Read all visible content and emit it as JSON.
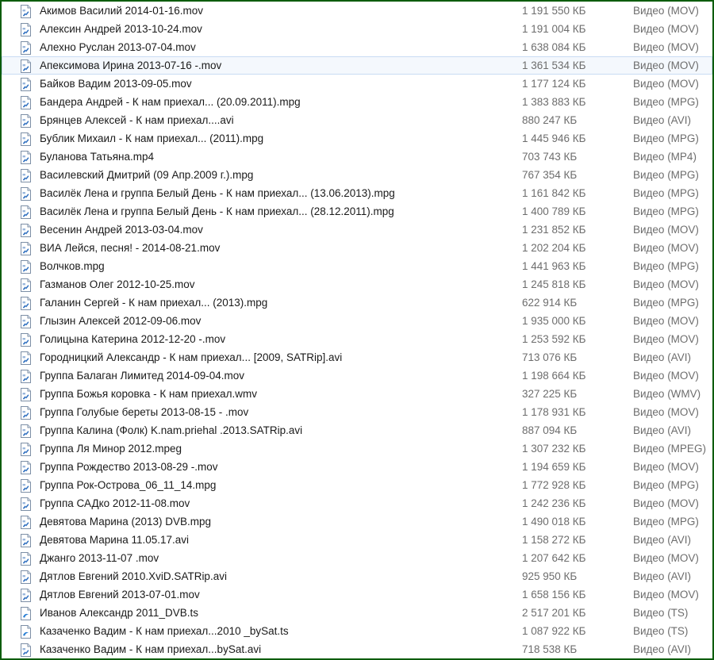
{
  "file_list": {
    "hover_row_index": 3,
    "rows": [
      {
        "name": "Акимов Василий 2014-01-16.mov",
        "size": "1 191 550 КБ",
        "type": "Видео (MOV)",
        "icon": "video-file-icon"
      },
      {
        "name": "Алексин Андрей 2013-10-24.mov",
        "size": "1 191 004 КБ",
        "type": "Видео (MOV)",
        "icon": "video-file-icon"
      },
      {
        "name": "Алехно Руслан 2013-07-04.mov",
        "size": "1 638 084 КБ",
        "type": "Видео (MOV)",
        "icon": "video-file-icon"
      },
      {
        "name": "Апексимова Ирина 2013-07-16 -.mov",
        "size": "1 361 534 КБ",
        "type": "Видео (MOV)",
        "icon": "video-file-icon"
      },
      {
        "name": "Байков Вадим 2013-09-05.mov",
        "size": "1 177 124 КБ",
        "type": "Видео (MOV)",
        "icon": "video-file-icon"
      },
      {
        "name": "Бандера Андрей - К нам приехал... (20.09.2011).mpg",
        "size": "1 383 883 КБ",
        "type": "Видео (MPG)",
        "icon": "video-file-icon"
      },
      {
        "name": "Брянцев Алексей - К нам приехал....avi",
        "size": "880 247 КБ",
        "type": "Видео (AVI)",
        "icon": "video-file-icon"
      },
      {
        "name": "Бублик Михаил - К нам приехал... (2011).mpg",
        "size": "1 445 946 КБ",
        "type": "Видео (MPG)",
        "icon": "video-file-icon"
      },
      {
        "name": "Буланова Татьяна.mp4",
        "size": "703 743 КБ",
        "type": "Видео (MP4)",
        "icon": "video-file-icon"
      },
      {
        "name": "Василевский Дмитрий (09 Апр.2009 г.).mpg",
        "size": "767 354 КБ",
        "type": "Видео (MPG)",
        "icon": "video-file-icon"
      },
      {
        "name": "Василёк Лена и группа Белый День - К нам приехал... (13.06.2013).mpg",
        "size": "1 161 842 КБ",
        "type": "Видео (MPG)",
        "icon": "video-file-icon"
      },
      {
        "name": "Василёк Лена и группа Белый День - К нам приехал... (28.12.2011).mpg",
        "size": "1 400 789 КБ",
        "type": "Видео (MPG)",
        "icon": "video-file-icon"
      },
      {
        "name": "Весенин Андрей 2013-03-04.mov",
        "size": "1 231 852 КБ",
        "type": "Видео (MOV)",
        "icon": "video-file-icon"
      },
      {
        "name": "ВИА Лейся, песня! - 2014-08-21.mov",
        "size": "1 202 204 КБ",
        "type": "Видео (MOV)",
        "icon": "video-file-icon"
      },
      {
        "name": "Волчков.mpg",
        "size": "1 441 963 КБ",
        "type": "Видео (MPG)",
        "icon": "video-file-icon"
      },
      {
        "name": "Газманов Олег 2012-10-25.mov",
        "size": "1 245 818 КБ",
        "type": "Видео (MOV)",
        "icon": "video-file-icon"
      },
      {
        "name": "Галанин Сергей - К нам приехал... (2013).mpg",
        "size": "622 914 КБ",
        "type": "Видео (MPG)",
        "icon": "video-file-icon"
      },
      {
        "name": "Глызин Алексей 2012-09-06.mov",
        "size": "1 935 000 КБ",
        "type": "Видео (MOV)",
        "icon": "video-file-icon"
      },
      {
        "name": "Голицына Катерина 2012-12-20 -.mov",
        "size": "1 253 592 КБ",
        "type": "Видео (MOV)",
        "icon": "video-file-icon"
      },
      {
        "name": "Городницкий Александр - К нам приехал...  [2009, SATRip].avi",
        "size": "713 076 КБ",
        "type": "Видео (AVI)",
        "icon": "video-file-icon"
      },
      {
        "name": "Группа Балаган Лимитед 2014-09-04.mov",
        "size": "1 198 664 КБ",
        "type": "Видео (MOV)",
        "icon": "video-file-icon"
      },
      {
        "name": "Группа Божья коровка - К нам приехал.wmv",
        "size": "327 225 КБ",
        "type": "Видео (WMV)",
        "icon": "video-file-icon"
      },
      {
        "name": "Группа Голубые береты 2013-08-15 - .mov",
        "size": "1 178 931 КБ",
        "type": "Видео (MOV)",
        "icon": "video-file-icon"
      },
      {
        "name": "Группа Калина (Фолк) K.nam.priehal .2013.SATRip.avi",
        "size": "887 094 КБ",
        "type": "Видео (AVI)",
        "icon": "video-file-icon"
      },
      {
        "name": "Группа Ля Минор 2012.mpeg",
        "size": "1 307 232 КБ",
        "type": "Видео (MPEG)",
        "icon": "video-file-icon"
      },
      {
        "name": "Группа Рождество 2013-08-29 -.mov",
        "size": "1 194 659 КБ",
        "type": "Видео (MOV)",
        "icon": "video-file-icon"
      },
      {
        "name": "Группа Рок-Острова_06_11_14.mpg",
        "size": "1 772 928 КБ",
        "type": "Видео (MPG)",
        "icon": "video-file-icon"
      },
      {
        "name": "Группа САДко 2012-11-08.mov",
        "size": "1 242 236 КБ",
        "type": "Видео (MOV)",
        "icon": "video-file-icon"
      },
      {
        "name": "Девятова Марина (2013) DVB.mpg",
        "size": "1 490 018 КБ",
        "type": "Видео (MPG)",
        "icon": "video-file-icon"
      },
      {
        "name": "Девятова Марина 11.05.17.avi",
        "size": "1 158 272 КБ",
        "type": "Видео (AVI)",
        "icon": "video-file-icon"
      },
      {
        "name": "Джанго 2013-11-07 .mov",
        "size": "1 207 642 КБ",
        "type": "Видео (MOV)",
        "icon": "video-file-icon"
      },
      {
        "name": "Дятлов Евгений 2010.XviD.SATRip.avi",
        "size": "925 950 КБ",
        "type": "Видео (AVI)",
        "icon": "video-file-icon"
      },
      {
        "name": "Дятлов Евгений 2013-07-01.mov",
        "size": "1 658 156 КБ",
        "type": "Видео (MOV)",
        "icon": "video-file-icon"
      },
      {
        "name": "Иванов Александр 2011_DVB.ts",
        "size": "2 517 201 КБ",
        "type": "Видео (TS)",
        "icon": "ts-file-icon"
      },
      {
        "name": "Казаченко Вадим - К нам приехал...2010 _bySat.ts",
        "size": "1 087 922 КБ",
        "type": "Видео (TS)",
        "icon": "ts-file-icon"
      },
      {
        "name": "Казаченко Вадим - К нам приехал...bySat.avi",
        "size": "718 538 КБ",
        "type": "Видео (AVI)",
        "icon": "video-file-icon"
      }
    ]
  }
}
